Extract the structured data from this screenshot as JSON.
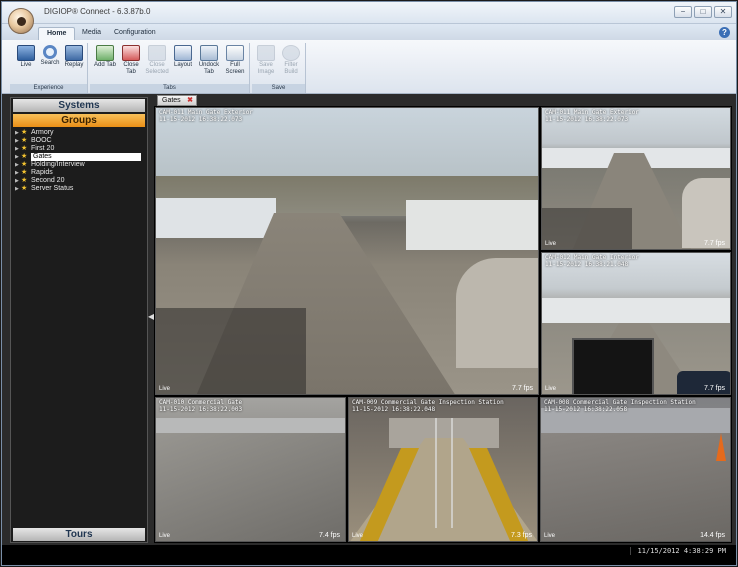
{
  "window": {
    "title": "DIGIOP® Connect  -  6.3.87b.0",
    "min_glyph": "−",
    "max_glyph": "□",
    "close_glyph": "✕"
  },
  "ribbon": {
    "tabs": [
      {
        "label": "Home",
        "active": true
      },
      {
        "label": "Media",
        "active": false
      },
      {
        "label": "Configuration",
        "active": false
      }
    ],
    "help_glyph": "?",
    "groups": [
      {
        "label": "Experience",
        "buttons": [
          {
            "label": "Live",
            "icon": "monitor-icon",
            "enabled": true
          },
          {
            "label": "Search",
            "icon": "magnifier-icon",
            "enabled": true
          },
          {
            "label": "Replay",
            "icon": "replay-icon",
            "enabled": true
          }
        ]
      },
      {
        "label": "Tabs",
        "buttons": [
          {
            "label": "Add Tab",
            "icon": "add-tab-icon",
            "enabled": true
          },
          {
            "label": "Close Tab",
            "icon": "close-tab-icon",
            "enabled": true
          },
          {
            "label": "Close Selected",
            "icon": "close-selected-icon",
            "enabled": false
          },
          {
            "label": "Layout",
            "icon": "layout-icon",
            "enabled": true
          },
          {
            "label": "Undock Tab",
            "icon": "undock-icon",
            "enabled": true
          },
          {
            "label": "Full Screen",
            "icon": "fullscreen-icon",
            "enabled": true
          }
        ]
      },
      {
        "label": "Save",
        "buttons": [
          {
            "label": "Save Image",
            "icon": "save-image-icon",
            "enabled": false
          },
          {
            "label": "Filter Build",
            "icon": "filter-icon",
            "enabled": false
          }
        ]
      }
    ]
  },
  "sidebar": {
    "systems_label": "Systems",
    "groups_label": "Groups",
    "tours_label": "Tours",
    "collapse_glyph": "◀",
    "expander_glyph": "▶",
    "star_glyph": "★",
    "items": [
      {
        "label": "Armory",
        "selected": false
      },
      {
        "label": "BOOC",
        "selected": false
      },
      {
        "label": "First 20",
        "selected": false
      },
      {
        "label": "Gates",
        "selected": true
      },
      {
        "label": "Holding/Interview",
        "selected": false
      },
      {
        "label": "Rapids",
        "selected": false
      },
      {
        "label": "Second 20",
        "selected": false
      },
      {
        "label": "Server Status",
        "selected": false
      }
    ]
  },
  "content": {
    "tab_label": "Gates",
    "tab_close_glyph": "✖",
    "cameras": [
      {
        "name": "CAM-011 Main Gate Exterior",
        "timestamp": "11-15-2012 16:38:22.073",
        "status": "Live",
        "fps": "7.7 fps"
      },
      {
        "name": "CAM-011 Main Gate Exterior",
        "timestamp": "11-15-2012 16:38:22.073",
        "status": "Live",
        "fps": "7.7 fps"
      },
      {
        "name": "CAM-012 Main Gate Interior",
        "timestamp": "11-15-2012 16:38:21.048",
        "status": "Live",
        "fps": "7.7 fps"
      },
      {
        "name": "CAM-010 Commercial Gate",
        "timestamp": "11-15-2012 16:38:22.003",
        "status": "Live",
        "fps": "7.4 fps"
      },
      {
        "name": "CAM-009 Commercial Gate Inspection Station",
        "timestamp": "11-15-2012 16:38:22.048",
        "status": "Live",
        "fps": "7.3 fps"
      },
      {
        "name": "CAM-008 Commercial Gate Inspection Station",
        "timestamp": "11-15-2012 16:38:22.058",
        "status": "Live",
        "fps": "14.4 fps"
      }
    ]
  },
  "status": {
    "clock": "11/15/2012  4:38:29 PM"
  }
}
